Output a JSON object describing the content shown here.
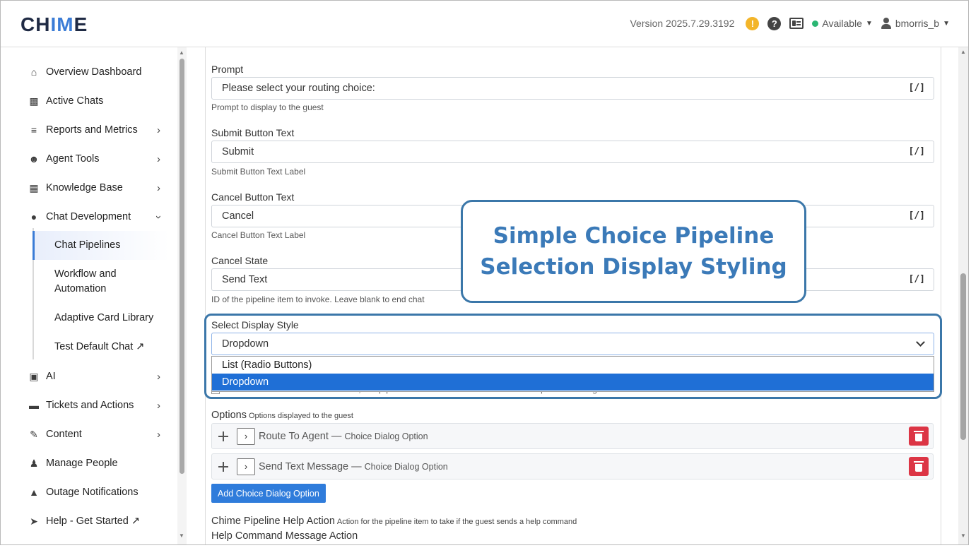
{
  "header": {
    "logo_pre": "CH",
    "logo_accent": "IM",
    "logo_post": "E",
    "version": "Version 2025.7.29.3192",
    "warn_glyph": "!",
    "help_glyph": "?",
    "status": "Available",
    "username": "bmorris_b"
  },
  "sidebar": {
    "items": [
      {
        "label": "Overview Dashboard",
        "icon": "home-icon"
      },
      {
        "label": "Active Chats",
        "icon": "chats-icon"
      },
      {
        "label": "Reports and Metrics",
        "icon": "chart-icon"
      },
      {
        "label": "Agent Tools",
        "icon": "users-icon"
      },
      {
        "label": "Knowledge Base",
        "icon": "book-icon"
      },
      {
        "label": "Chat Development",
        "icon": "comment-icon"
      },
      {
        "label": "AI",
        "icon": "robot-icon"
      },
      {
        "label": "Tickets and Actions",
        "icon": "ticket-icon"
      },
      {
        "label": "Content",
        "icon": "edit-icon"
      },
      {
        "label": "Manage People",
        "icon": "person-icon"
      },
      {
        "label": "Outage Notifications",
        "icon": "warning-icon"
      },
      {
        "label": "Help - Get Started ↗",
        "icon": "rocket-icon"
      }
    ],
    "sub_items": [
      {
        "label": "Chat Pipelines"
      },
      {
        "label": "Workflow and Automation"
      },
      {
        "label": "Adaptive Card Library"
      },
      {
        "label": "Test Default Chat ↗"
      }
    ]
  },
  "form": {
    "prompt": {
      "label": "Prompt",
      "value": "Please select your routing choice:",
      "help": "Prompt to display to the guest"
    },
    "submit": {
      "label": "Submit Button Text",
      "value": "Submit",
      "help": "Submit Button Text Label"
    },
    "cancel": {
      "label": "Cancel Button Text",
      "value": "Cancel",
      "help": "Cancel Button Text Label"
    },
    "cancel_state": {
      "label": "Cancel State",
      "value": "Send Text",
      "help": "ID of the pipeline item to invoke. Leave blank to end chat"
    },
    "token_glyph": "[/]",
    "display_style": {
      "label": "Select Display Style",
      "value": "Dropdown",
      "options": [
        "List (Radio Buttons)",
        "Dropdown"
      ],
      "selected_index": 1
    },
    "hidden_row": "Idle Timeout Enabled?  If enabled, the pipeline item will timeout if there is no input from the guest",
    "options": {
      "label": "Options",
      "help": "Options displayed to the guest",
      "rows": [
        {
          "title": "Route To Agent —",
          "subtitle": "Choice Dialog Option"
        },
        {
          "title": "Send Text Message —",
          "subtitle": "Choice Dialog Option"
        }
      ],
      "add_button": "Add Choice Dialog Option"
    },
    "help_action": {
      "label": "Chime Pipeline Help Action",
      "help": "Action for the pipeline item to take if the guest sends a help command"
    },
    "help_message": {
      "label": "Help Command Message Action"
    }
  },
  "callout": {
    "line1": "Simple Choice Pipeline",
    "line2": "Selection Display Styling"
  },
  "colors": {
    "accent": "#3b7cd6",
    "callout": "#3b77a9",
    "danger": "#dc3545",
    "available": "#2bb673",
    "warning": "#f3b52a"
  }
}
